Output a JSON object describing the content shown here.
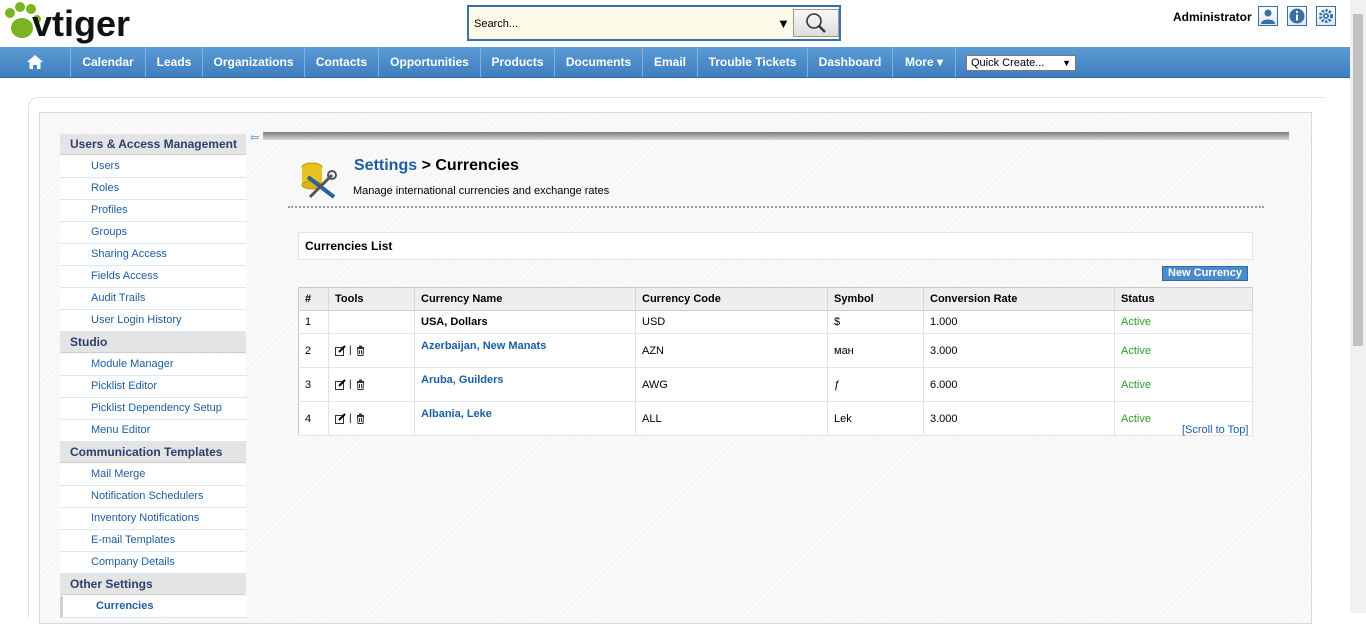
{
  "header": {
    "logo_text": "vtiger",
    "search_placeholder": "Search...",
    "user_name": "Administrator",
    "icons": [
      "user-profile-icon",
      "info-icon",
      "gear-icon"
    ]
  },
  "menu": {
    "items": [
      "Calendar",
      "Leads",
      "Organizations",
      "Contacts",
      "Opportunities",
      "Products",
      "Documents",
      "Email",
      "Trouble Tickets",
      "Dashboard",
      "More ▾"
    ],
    "quick_create": "Quick Create..."
  },
  "sidebar": {
    "sections": [
      {
        "heading": "Users & Access Management",
        "items": [
          "Users",
          "Roles",
          "Profiles",
          "Groups",
          "Sharing Access",
          "Fields Access",
          "Audit Trails",
          "User Login History"
        ]
      },
      {
        "heading": "Studio",
        "items": [
          "Module Manager",
          "Picklist Editor",
          "Picklist Dependency Setup",
          "Menu Editor"
        ]
      },
      {
        "heading": "Communication Templates",
        "items": [
          "Mail Merge",
          "Notification Schedulers",
          "Inventory Notifications",
          "E-mail Templates",
          "Company Details"
        ]
      },
      {
        "heading": "Other Settings",
        "items": [
          "Currencies"
        ]
      }
    ],
    "active_item": "Currencies"
  },
  "page": {
    "breadcrumb_settings": "Settings",
    "breadcrumb_sep": " > ",
    "breadcrumb_current": "Currencies",
    "subtitle": "Manage international currencies and exchange rates",
    "list_title": "Currencies List",
    "new_button": "New Currency",
    "scroll_top": "[Scroll to Top]"
  },
  "table": {
    "columns": [
      "#",
      "Tools",
      "Currency Name",
      "Currency Code",
      "Symbol",
      "Conversion Rate",
      "Status"
    ],
    "rows": [
      {
        "num": "1",
        "name": "USA, Dollars",
        "code": "USD",
        "symbol": "$",
        "rate": "1.000",
        "status": "Active",
        "editable": false
      },
      {
        "num": "2",
        "name": "Azerbaijan, New Manats",
        "code": "AZN",
        "symbol": "ман",
        "rate": "3.000",
        "status": "Active",
        "editable": true
      },
      {
        "num": "3",
        "name": "Aruba, Guilders",
        "code": "AWG",
        "symbol": "ƒ",
        "rate": "6.000",
        "status": "Active",
        "editable": true
      },
      {
        "num": "4",
        "name": "Albania, Leke",
        "code": "ALL",
        "symbol": "Lek",
        "rate": "3.000",
        "status": "Active",
        "editable": true
      }
    ]
  },
  "colors": {
    "menu_bar": "#4a8bcb",
    "link": "#1d5ea3",
    "status_active": "#2e9b2e",
    "sidebar_heading_text": "#2b3f6e"
  }
}
